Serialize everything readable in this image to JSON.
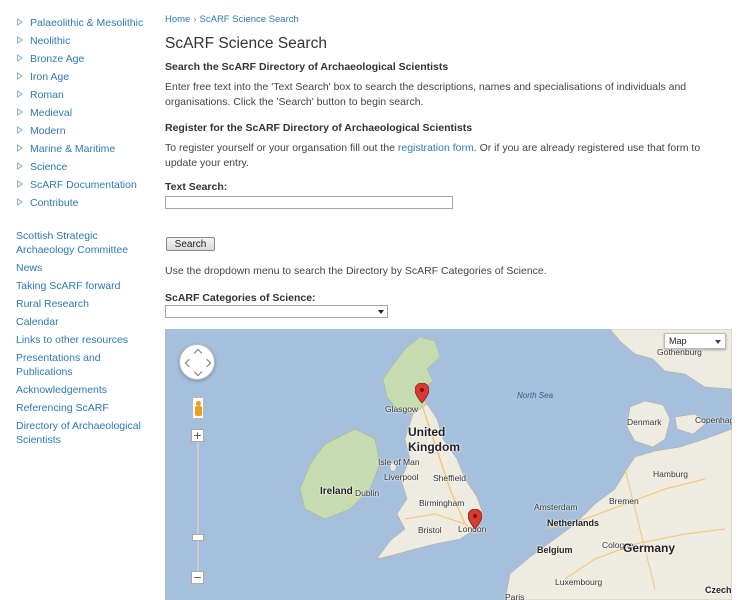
{
  "sidebar": {
    "sub_items": [
      {
        "label": "Palaeolithic & Mesolithic"
      },
      {
        "label": "Neolithic"
      },
      {
        "label": "Bronze Age"
      },
      {
        "label": "Iron Age"
      },
      {
        "label": "Roman"
      },
      {
        "label": "Medieval"
      },
      {
        "label": "Modern"
      },
      {
        "label": "Marine & Maritime"
      },
      {
        "label": "Science"
      },
      {
        "label": "ScARF Documentation"
      },
      {
        "label": "Contribute"
      }
    ],
    "top_items": [
      {
        "label": "Scottish Strategic Archaeology Committee"
      },
      {
        "label": "News"
      },
      {
        "label": "Taking ScARF forward"
      },
      {
        "label": "Rural Research"
      },
      {
        "label": "Calendar"
      },
      {
        "label": "Links to other resources"
      },
      {
        "label": "Presentations and Publications"
      },
      {
        "label": "Acknowledgements"
      },
      {
        "label": "Referencing ScARF"
      },
      {
        "label": "Directory of Archaeological Scientists"
      }
    ]
  },
  "breadcrumb": {
    "home": "Home",
    "separator": "›",
    "current": "ScARF Science Search"
  },
  "page": {
    "title": "ScARF Science Search",
    "search_heading": "Search the ScARF Directory of Archaeological Scientists",
    "search_text": "Enter free text into the 'Text Search' box to search the descriptions, names and specialisations of individuals and organisations. Click the 'Search' button to begin search.",
    "register_heading": "Register for the ScARF Directory of Archaeological Scientists",
    "register_text_before": "To register yourself or your organsation fill out the ",
    "register_link": "registration form",
    "register_text_after": ". Or if you are already registered use that form to update your entry.",
    "text_search_label": "Text Search:",
    "text_search_value": "",
    "search_button": "Search",
    "dropdown_text": "Use the dropdown menu to search the Directory by ScARF Categories of Science.",
    "categories_label": "ScARF Categories of Science:",
    "categories_selected": ""
  },
  "map": {
    "type_label": "Map",
    "zoom_in": "+",
    "zoom_out": "−",
    "colors": {
      "sea": "#a5bfdd",
      "land": "#eeebe0",
      "green": "#c6dbb0",
      "pin": "#d63a30"
    },
    "labels": {
      "gothenburg": "Gothenburg",
      "north_sea": "North Sea",
      "glasgow": "Glasgow",
      "denmark": "Denmark",
      "copenhagen": "Copenhag",
      "united": "United",
      "kingdom": "Kingdom",
      "isle_of_man": "Isle of Man",
      "ireland": "Ireland",
      "dublin": "Dublin",
      "liverpool": "Liverpool",
      "sheffield": "Sheffield",
      "hamburg": "Hamburg",
      "bremen": "Bremen",
      "birmingham": "Birmingham",
      "amsterdam": "Amsterdam",
      "netherlands": "Netherlands",
      "bristol": "Bristol",
      "london": "London",
      "cologne": "Cologne",
      "belgium": "Belgium",
      "germany": "Germany",
      "luxembourg": "Luxembourg",
      "czech": "Czech",
      "paris": "Paris"
    }
  }
}
